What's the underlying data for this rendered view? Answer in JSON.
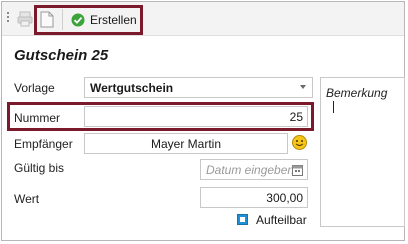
{
  "toolbar": {
    "create_label": "Erstellen"
  },
  "title": "Gutschein 25",
  "form": {
    "template_label": "Vorlage",
    "template_value": "Wertgutschein",
    "number_label": "Nummer",
    "number_value": "25",
    "recipient_label": "Empfänger",
    "recipient_value": "Mayer Martin",
    "valid_label": "Gültig bis",
    "valid_placeholder": "Datum eingeben",
    "value_label": "Wert",
    "value_value": "300,00",
    "split_label": "Aufteilbar",
    "split_checked": true
  },
  "remark": {
    "placeholder": "Bemerkung"
  },
  "colors": {
    "highlight": "#7a1a2b",
    "check": "#1e90d6",
    "create_icon": "#3aa33a"
  }
}
